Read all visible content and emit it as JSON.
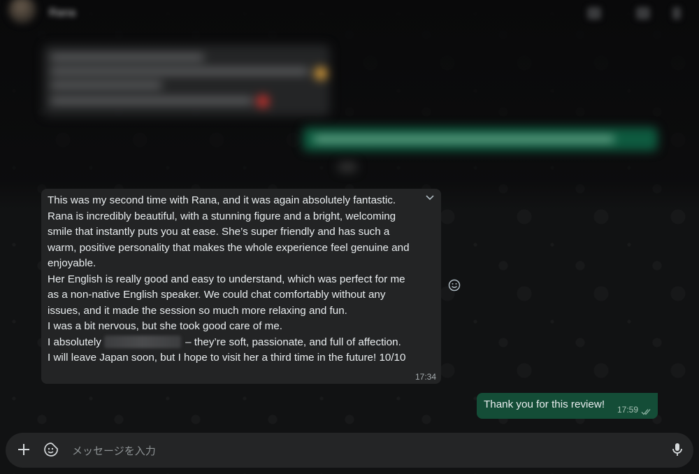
{
  "header": {
    "contact_name": "Rana"
  },
  "incoming_message": {
    "lines": [
      "This was my second time with Rana, and it was again absolutely fantastic.",
      "Rana is incredibly beautiful, with a stunning figure and a bright, welcoming",
      "smile that instantly puts you at ease. She’s super friendly and has such a",
      "warm, positive personality that makes the whole experience feel genuine and",
      "enjoyable.",
      "Her English is really good and easy to understand, which was perfect for me",
      "as a non-native English speaker. We could chat comfortably without any",
      "issues, and it made the session so much more relaxing and fun.",
      "I was a bit nervous, but she took good care of me."
    ],
    "censored_line_prefix": "I absolutely",
    "censored_line_suffix": "– they’re soft, passionate, and full of affection.",
    "last_line": "I will leave Japan soon, but I hope to visit her a third time in the future! 10/10",
    "time": "17:34"
  },
  "outgoing_message": {
    "text": "Thank you for this review!",
    "time": "17:59",
    "status": "read"
  },
  "composer": {
    "placeholder": "メッセージを入力"
  },
  "colors": {
    "incoming_bubble": "#232425",
    "outgoing_bubble": "#144d37",
    "read_tick": "#8fb4a4",
    "background": "#111213"
  }
}
